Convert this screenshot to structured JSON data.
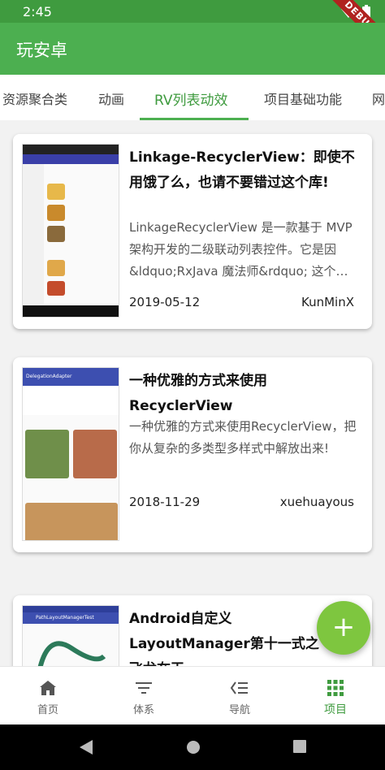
{
  "status": {
    "time": "2:45",
    "debug_label": "DEBUG"
  },
  "app": {
    "title": "玩安卓",
    "brand_color": "#4caf50"
  },
  "tabs": [
    {
      "label": "资源聚合类"
    },
    {
      "label": "动画"
    },
    {
      "label": "RV列表动效",
      "active": true
    },
    {
      "label": "项目基础功能"
    },
    {
      "label": "网"
    }
  ],
  "articles": [
    {
      "title": "Linkage-RecyclerView：即使不用饿了么，也请不要错过这个库!",
      "desc": "LinkageRecyclerView 是一款基于 MVP 架构开发的二级联动列表控件。它是因&ldquo;RxJava 魔法师&rdquo; 这个…",
      "date": "2019-05-12",
      "author": "KunMinX"
    },
    {
      "title": "一种优雅的方式来使用RecyclerView",
      "desc": "一种优雅的方式来使用RecyclerView，把你从复杂的多类型多样式中解放出来!",
      "date": "2018-11-29",
      "author": "xuehuayous"
    },
    {
      "title": "Android自定义LayoutManager第十一式之飞龙在天PathLayoutManager",
      "desc": "",
      "date": "",
      "author": ""
    }
  ],
  "thumbs": {
    "delegation_header": "DelegationAdapter",
    "path_header": "PathLayoutManagerTest"
  },
  "fab": {
    "label": "+"
  },
  "bottom_nav": [
    {
      "label": "首页",
      "icon": "home-icon"
    },
    {
      "label": "体系",
      "icon": "filter-list-icon"
    },
    {
      "label": "导航",
      "icon": "navigation-list-icon"
    },
    {
      "label": "项目",
      "icon": "grid-icon",
      "active": true
    }
  ]
}
